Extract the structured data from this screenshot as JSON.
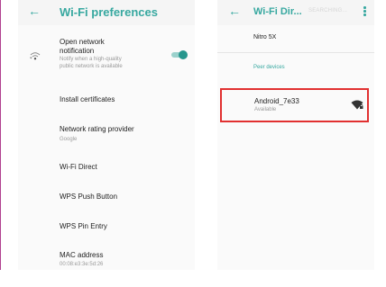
{
  "colors": {
    "accent": "#37a8a0",
    "toggle_on": "#26968d",
    "highlight": "#e13030",
    "background": "#fafafa"
  },
  "left_screen": {
    "appbar": {
      "back_icon": "arrow-back-icon",
      "title": "Wi-Fi preferences"
    },
    "items": [
      {
        "title_line1": "Open network",
        "title_line2": "notification",
        "sub_line1": "Notify when a high-quality",
        "sub_line2": "public network is available",
        "icon": "wifi-notification-icon",
        "toggle_on": true
      },
      {
        "title": "Install certificates"
      },
      {
        "title": "Network rating provider",
        "subtitle": "Google"
      },
      {
        "title": "Wi-Fi Direct"
      },
      {
        "title": "WPS Push Button"
      },
      {
        "title": "WPS Pin Entry"
      },
      {
        "title": "MAC address",
        "subtitle": "00:08:e3:3e:5d:26"
      }
    ]
  },
  "right_screen": {
    "appbar": {
      "back_icon": "arrow-back-icon",
      "title": "Wi-Fi Dir...",
      "status": "SEARCHING...",
      "menu_icon": "overflow-menu-icon"
    },
    "device_name": "Nitro 5X",
    "peer_header": "Peer devices",
    "peers": [
      {
        "name": "Android_7e33",
        "status": "Available",
        "icon": "wifi-signal-lock-icon"
      }
    ]
  }
}
